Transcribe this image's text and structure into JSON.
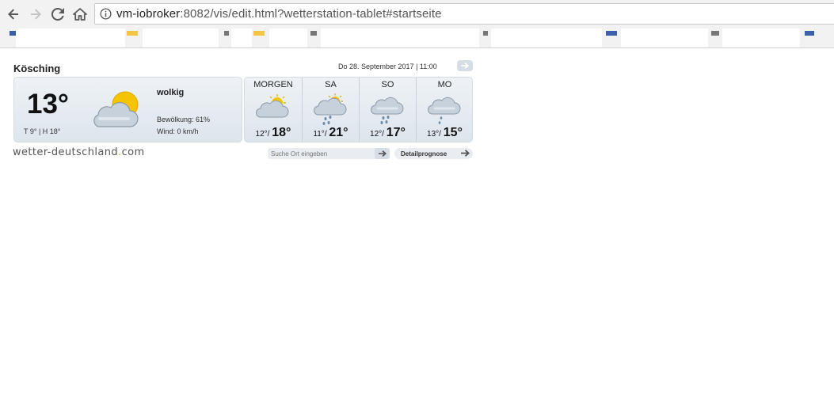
{
  "browser": {
    "url_host": "vm-iobroker",
    "url_path": ":8082/vis/edit.html?wetterstation-tablet#startseite",
    "icons": [
      "back-arrow-icon",
      "forward-arrow-icon",
      "reload-icon",
      "home-icon",
      "info-icon"
    ]
  },
  "weather": {
    "city": "Kösching",
    "date": "Do 28. September 2017 | 11:00",
    "current": {
      "temp": "13°",
      "minmax": "T 9° | H 18°",
      "condition": "wolkig",
      "cloudiness": "Bewölkung: 61%",
      "wind": "Wind: 0 km/h",
      "icon": "partly-cloudy-icon"
    },
    "forecast": [
      {
        "label": "MORGEN",
        "min": "12°",
        "max": "18°",
        "icon": "partly-cloudy-icon"
      },
      {
        "label": "SA",
        "min": "11°",
        "max": "21°",
        "icon": "cloud-sun-rain-icon"
      },
      {
        "label": "SO",
        "min": "12°",
        "max": "17°",
        "icon": "cloud-rain-icon"
      },
      {
        "label": "MO",
        "min": "13°",
        "max": "15°",
        "icon": "cloud-drizzle-icon"
      }
    ],
    "logo_main": "wetter-deutschland",
    "logo_dot": ".",
    "logo_tld": "com",
    "search_placeholder": "Suche Ort eingeben",
    "detail_label": "Detailprognose"
  },
  "colors": {
    "card_top": "#eef2f6",
    "card_bottom": "#dde5ed",
    "logo_dot": "#f0b000",
    "sun": "#f5c400",
    "cloud": "#b9c6d2"
  }
}
